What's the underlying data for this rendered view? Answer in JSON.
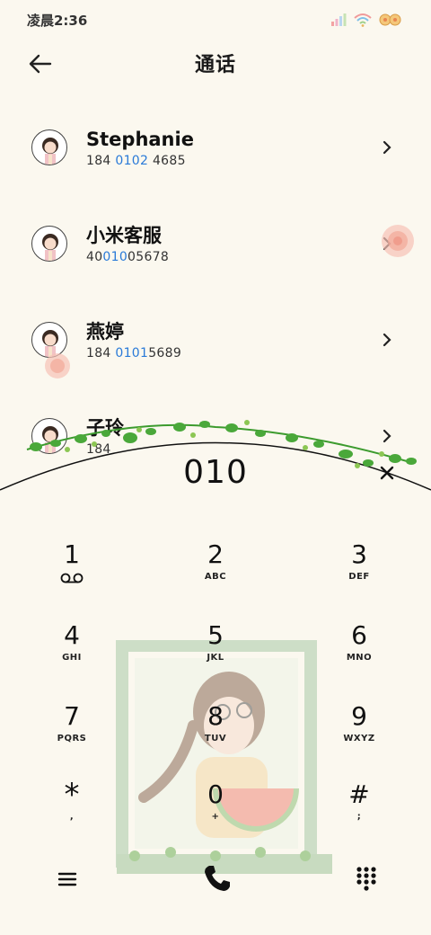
{
  "status_bar": {
    "time": "凌晨2:36"
  },
  "header": {
    "title": "通话"
  },
  "contacts": [
    {
      "name": "Stephanie",
      "number_pre": "184 ",
      "number_hl": "0102",
      "number_post": " 4685"
    },
    {
      "name": "小米客服",
      "number_pre": "40",
      "number_hl": "010",
      "number_post": "05678"
    },
    {
      "name": "燕婷",
      "number_pre": "184 ",
      "number_hl": "0101",
      "number_post": "5689"
    },
    {
      "name": "子玲",
      "number_pre": "184",
      "number_hl": "",
      "number_post": ""
    }
  ],
  "dialer": {
    "input": "010"
  },
  "keypad": [
    {
      "digit": "1",
      "sub": ""
    },
    {
      "digit": "2",
      "sub": "ABC"
    },
    {
      "digit": "3",
      "sub": "DEF"
    },
    {
      "digit": "4",
      "sub": "GHI"
    },
    {
      "digit": "5",
      "sub": "JKL"
    },
    {
      "digit": "6",
      "sub": "MNO"
    },
    {
      "digit": "7",
      "sub": "PQRS"
    },
    {
      "digit": "8",
      "sub": "TUV"
    },
    {
      "digit": "9",
      "sub": "WXYZ"
    },
    {
      "digit": "*",
      "sub": ","
    },
    {
      "digit": "0",
      "sub": "+"
    },
    {
      "digit": "#",
      "sub": ";"
    }
  ],
  "colors": {
    "background": "#fbf8ef",
    "highlight": "#2a7ad8",
    "leaf": "#3c9b2e"
  }
}
